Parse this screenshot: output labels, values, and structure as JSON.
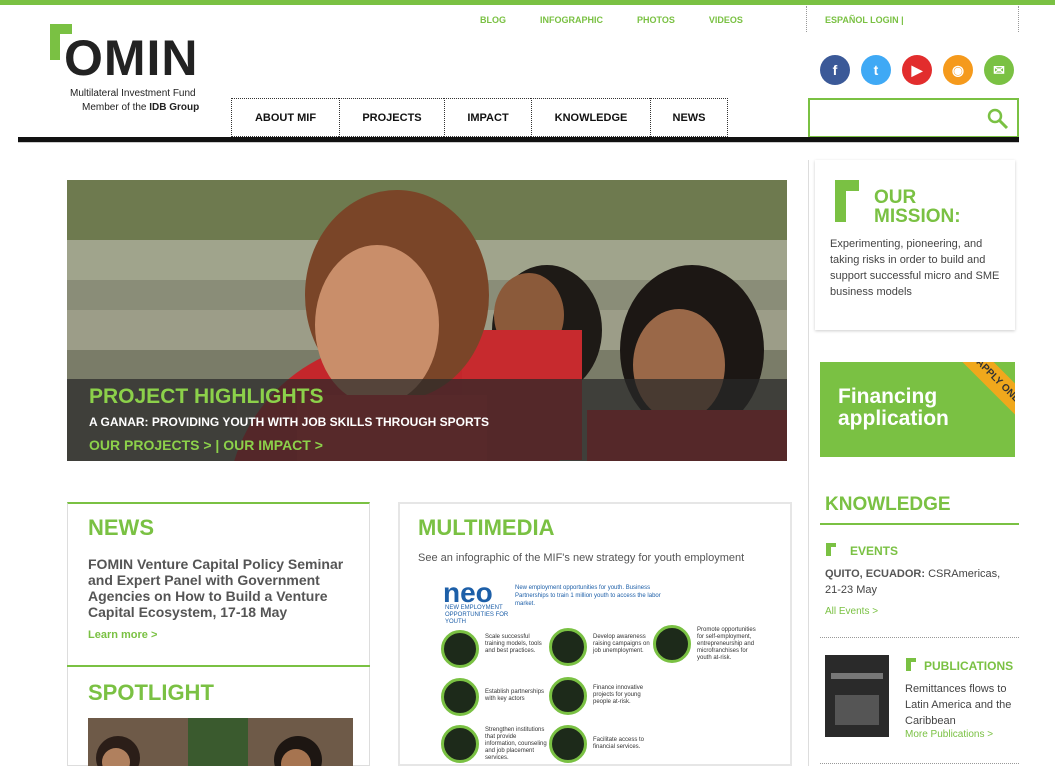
{
  "top_links": [
    "BLOG",
    "INFOGRAPHIC",
    "PHOTOS",
    "VIDEOS"
  ],
  "lang_links": "ESPAÑOL  LOGIN |",
  "logo": {
    "word": "OMIN",
    "tagline1": "Multilateral Investment Fund",
    "tagline2_prefix": "Member of the ",
    "tagline2_bold": "IDB Group"
  },
  "nav": [
    "ABOUT MIF",
    "PROJECTS",
    "IMPACT",
    "KNOWLEDGE",
    "NEWS"
  ],
  "social": [
    {
      "icon": "facebook-icon",
      "glyph": "f",
      "color": "#3b5998"
    },
    {
      "icon": "twitter-icon",
      "glyph": "t",
      "color": "#3fa9f5"
    },
    {
      "icon": "youtube-icon",
      "glyph": "▶",
      "color": "#e22d2d"
    },
    {
      "icon": "rss-icon",
      "glyph": "◉",
      "color": "#f59a1c"
    },
    {
      "icon": "email-icon",
      "glyph": "✉",
      "color": "#7ac143"
    }
  ],
  "search": {
    "placeholder": ""
  },
  "hero": {
    "title": "PROJECT HIGHLIGHTS",
    "subtitle": "A GANAR: PROVIDING YOUTH WITH JOB SKILLS THROUGH SPORTS",
    "links": "OUR PROJECTS > | OUR IMPACT >"
  },
  "news": {
    "title": "NEWS",
    "headline": "FOMIN Venture Capital Policy Seminar and Expert Panel with Government Agencies on How to Build a Venture Capital Ecosystem, 17-18 May",
    "learn_more": "Learn more >"
  },
  "spotlight": {
    "title": "SPOTLIGHT"
  },
  "multimedia": {
    "title": "MULTIMEDIA",
    "subtitle": "See an infographic of the MIF's new strategy for youth employment",
    "infographic": {
      "logo": "neo",
      "logo_sub": "NEW EMPLOYMENT OPPORTUNITIES FOR YOUTH",
      "top_note": "New employment opportunities for youth. Business Partnerships to train 1 million youth to access the labor market.",
      "items": [
        "Scale successful training models, tools and best practices.",
        "Develop awareness raising campaigns on job unemployment.",
        "Promote opportunities for self-employment, entrepreneurship and microfranchises for youth at-risk.",
        "Establish partnerships with key actors",
        "Finance innovative projects for young people at-risk.",
        "Strengthen institutions that provide information, counseling and job placement services.",
        "Facilitate access to financial services."
      ]
    }
  },
  "mission": {
    "title_line1": "OUR",
    "title_line2": "MISSION:",
    "body": "Experimenting, pioneering, and taking risks in order to build and support successful micro and SME business models"
  },
  "financing": {
    "line1": "Financing",
    "line2": "application",
    "ribbon": "APPLY ONLINE"
  },
  "knowledge": {
    "title": "KNOWLEDGE",
    "events_label": "EVENTS",
    "event_place": "QUITO, ECUADOR:",
    "event_text": " CSRAmericas, 21-23 May",
    "all_events": "All Events >",
    "publications_label": "PUBLICATIONS",
    "publication_text": "Remittances flows to Latin America and the Caribbean",
    "more_publications": "More Publications >"
  },
  "colors": {
    "accent": "#7ac143",
    "dark": "#111111"
  }
}
